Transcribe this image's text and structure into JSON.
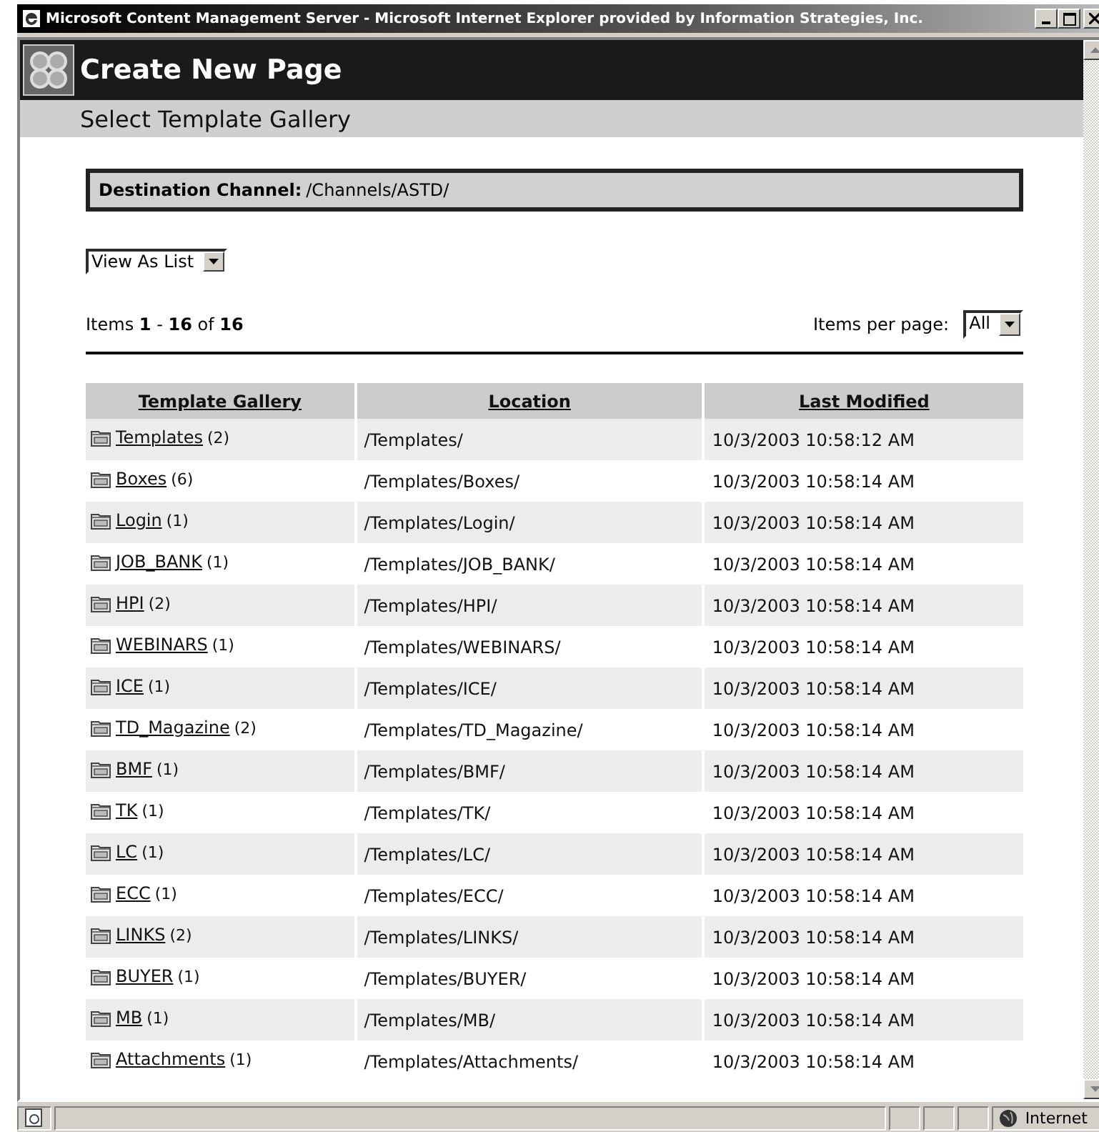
{
  "window": {
    "title": "Microsoft Content Management Server - Microsoft Internet Explorer provided by Information Strategies, Inc."
  },
  "header": {
    "title": "Create New Page",
    "subtitle": "Select Template Gallery"
  },
  "destination": {
    "label": "Destination Channel:",
    "value": "/Channels/ASTD/"
  },
  "view_select": {
    "value": "View As List"
  },
  "paging": {
    "summary": "Items **1** - **16** of **16**",
    "per_page_label": "Items per page:",
    "per_page_value": "All"
  },
  "table": {
    "columns": [
      "Template Gallery",
      "Location",
      "Last Modified"
    ],
    "rows": [
      {
        "name": "Templates",
        "count": "(2)",
        "location": "/Templates/",
        "modified": "10/3/2003 10:58:12 AM"
      },
      {
        "name": "Boxes",
        "count": "(6)",
        "location": "/Templates/Boxes/",
        "modified": "10/3/2003 10:58:14 AM"
      },
      {
        "name": "Login",
        "count": "(1)",
        "location": "/Templates/Login/",
        "modified": "10/3/2003 10:58:14 AM"
      },
      {
        "name": "JOB_BANK",
        "count": "(1)",
        "location": "/Templates/JOB_BANK/",
        "modified": "10/3/2003 10:58:14 AM"
      },
      {
        "name": "HPI",
        "count": "(2)",
        "location": "/Templates/HPI/",
        "modified": "10/3/2003 10:58:14 AM"
      },
      {
        "name": "WEBINARS",
        "count": "(1)",
        "location": "/Templates/WEBINARS/",
        "modified": "10/3/2003 10:58:14 AM"
      },
      {
        "name": "ICE",
        "count": "(1)",
        "location": "/Templates/ICE/",
        "modified": "10/3/2003 10:58:14 AM"
      },
      {
        "name": "TD_Magazine",
        "count": "(2)",
        "location": "/Templates/TD_Magazine/",
        "modified": "10/3/2003 10:58:14 AM"
      },
      {
        "name": "BMF",
        "count": "(1)",
        "location": "/Templates/BMF/",
        "modified": "10/3/2003 10:58:14 AM"
      },
      {
        "name": "TK",
        "count": "(1)",
        "location": "/Templates/TK/",
        "modified": "10/3/2003 10:58:14 AM"
      },
      {
        "name": "LC",
        "count": "(1)",
        "location": "/Templates/LC/",
        "modified": "10/3/2003 10:58:14 AM"
      },
      {
        "name": "ECC",
        "count": "(1)",
        "location": "/Templates/ECC/",
        "modified": "10/3/2003 10:58:14 AM"
      },
      {
        "name": "LINKS",
        "count": "(2)",
        "location": "/Templates/LINKS/",
        "modified": "10/3/2003 10:58:14 AM"
      },
      {
        "name": "BUYER",
        "count": "(1)",
        "location": "/Templates/BUYER/",
        "modified": "10/3/2003 10:58:14 AM"
      },
      {
        "name": "MB",
        "count": "(1)",
        "location": "/Templates/MB/",
        "modified": "10/3/2003 10:58:14 AM"
      },
      {
        "name": "Attachments",
        "count": "(1)",
        "location": "/Templates/Attachments/",
        "modified": "10/3/2003 10:58:14 AM"
      }
    ]
  },
  "status_bar": {
    "zone": "Internet"
  }
}
